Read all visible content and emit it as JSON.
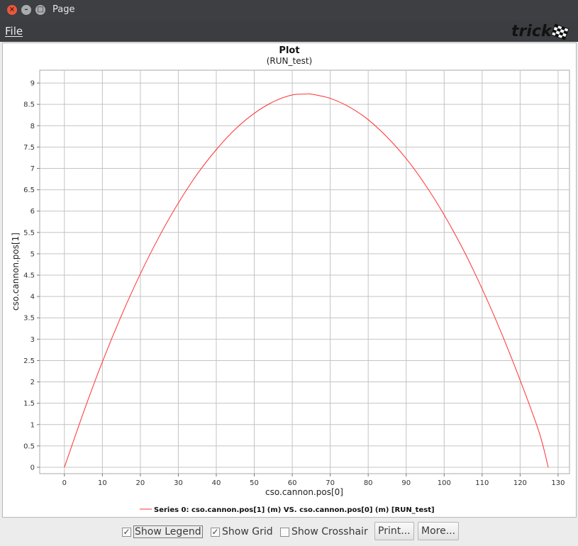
{
  "window": {
    "title": "Page",
    "controls": {
      "close": "×",
      "minimize": "–",
      "maximize": "□"
    }
  },
  "menu": {
    "file": "File"
  },
  "logo": {
    "text": "trick"
  },
  "chart_data": {
    "type": "line",
    "title": "Plot",
    "subtitle": "(RUN_test)",
    "xlabel": "cso.cannon.pos[0]",
    "ylabel": "cso.cannon.pos[1]",
    "xlim": [
      -6.5,
      133
    ],
    "ylim": [
      -0.15,
      9.3
    ],
    "x_ticks": [
      0,
      10,
      20,
      30,
      40,
      50,
      60,
      70,
      80,
      90,
      100,
      110,
      120,
      130
    ],
    "x_tick_labels": [
      "0",
      "10",
      "20",
      "30",
      "40",
      "50",
      "60",
      "70",
      "80",
      "90",
      "100",
      "110",
      "120",
      "130"
    ],
    "y_ticks": [
      0,
      0.5,
      1,
      1.5,
      2,
      2.5,
      3,
      3.5,
      4,
      4.5,
      5,
      5.5,
      6,
      6.5,
      7,
      7.5,
      8,
      8.5,
      9
    ],
    "y_tick_labels": [
      "0",
      "0.5",
      "1",
      "1.5",
      "2",
      "2.5",
      "3",
      "3.5",
      "4",
      "4.5",
      "5",
      "5.5",
      "6",
      "6.5",
      "7",
      "7.5",
      "8",
      "8.5",
      "9"
    ],
    "grid": true,
    "legend_position": "bottom",
    "series": [
      {
        "name": "Series 0: cso.cannon.pos[1] (m) VS. cso.cannon.pos[0] (m) [RUN_test]",
        "color": "#ff3030",
        "x": [
          0,
          5,
          10,
          15,
          20,
          25,
          30,
          35,
          40,
          45,
          50,
          55,
          60,
          63.7,
          65,
          70,
          75,
          80,
          85,
          90,
          95,
          100,
          105,
          110,
          115,
          120,
          125,
          127.4
        ],
        "y": [
          0,
          1.28,
          2.47,
          3.55,
          4.53,
          5.41,
          6.19,
          6.87,
          7.44,
          7.92,
          8.29,
          8.56,
          8.72,
          8.74,
          8.74,
          8.64,
          8.44,
          8.14,
          7.73,
          7.23,
          6.62,
          5.91,
          5.1,
          4.18,
          3.16,
          2.04,
          0.82,
          0
        ]
      }
    ],
    "line_color": "#ff3030",
    "grid_color": "#c4c4c4"
  },
  "controls": {
    "show_legend": {
      "label": "Show Legend",
      "checked": true
    },
    "show_grid": {
      "label": "Show Grid",
      "checked": true
    },
    "show_crosshair": {
      "label": "Show Crosshair",
      "checked": false
    },
    "print_button": "Print...",
    "more_button": "More..."
  }
}
